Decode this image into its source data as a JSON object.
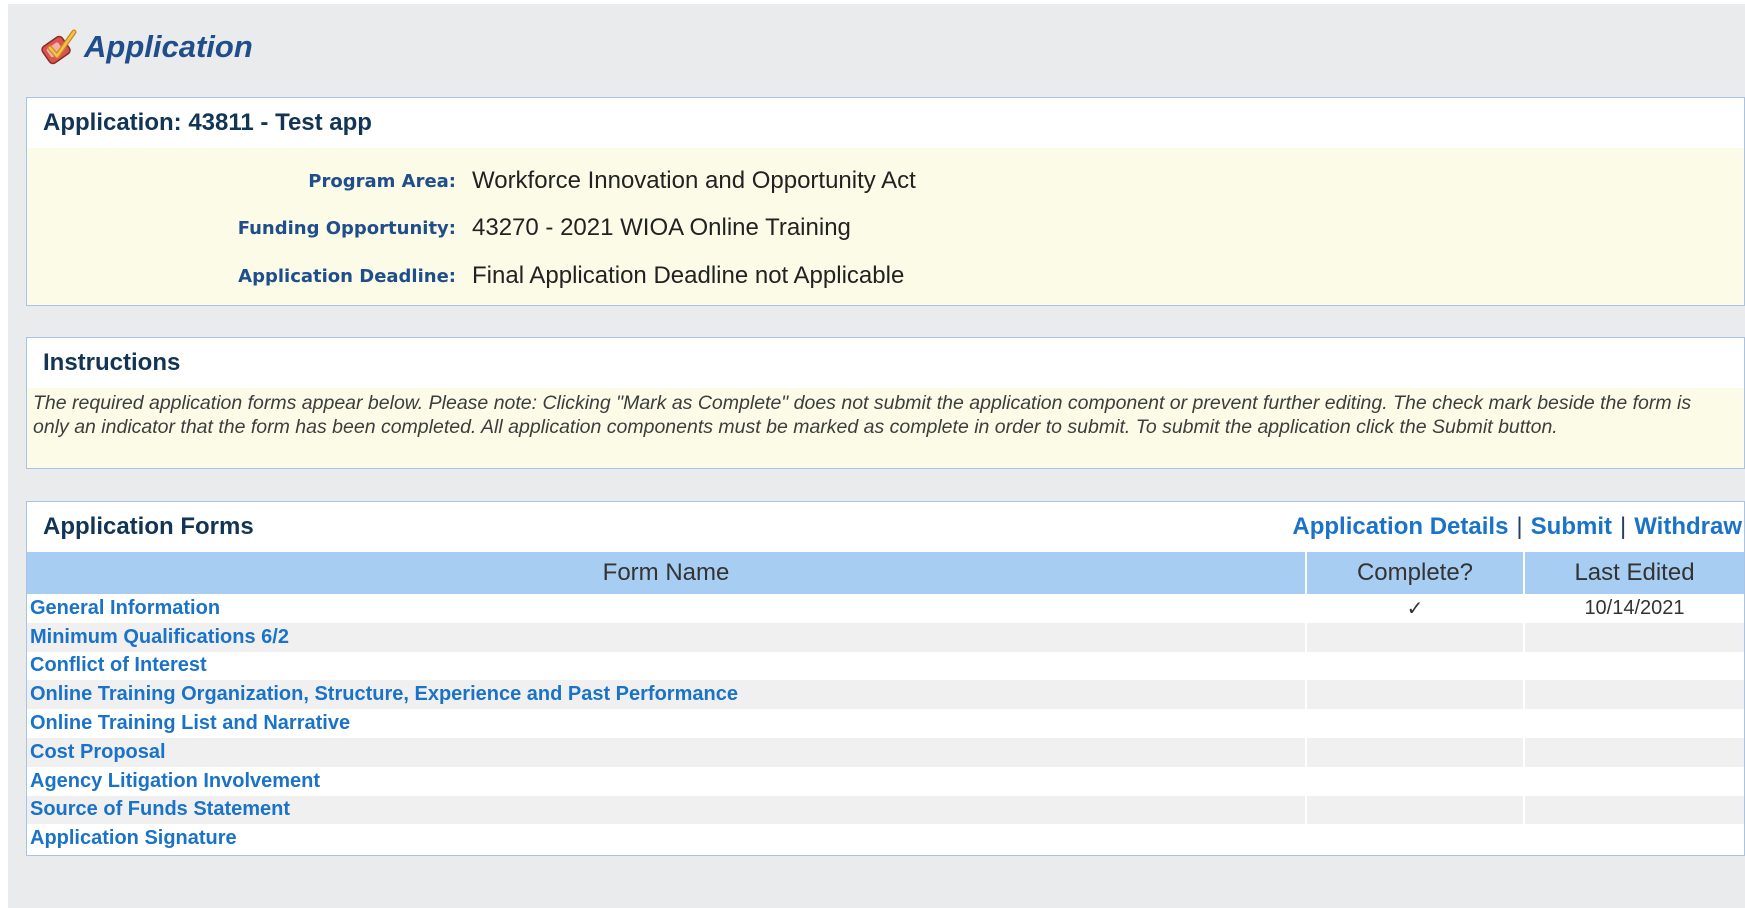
{
  "page": {
    "title": "Application",
    "icon": "checkmark-clipboard-icon"
  },
  "details": {
    "heading": "Application: 43811 - Test app",
    "fields": [
      {
        "label": "Program Area:",
        "value": "Workforce Innovation and Opportunity Act"
      },
      {
        "label": "Funding Opportunity:",
        "value": "43270 - 2021 WIOA Online Training"
      },
      {
        "label": "Application Deadline:",
        "value": "Final Application Deadline not Applicable"
      }
    ]
  },
  "instructions": {
    "heading": "Instructions",
    "text": "The required application forms appear below. Please note: Clicking \"Mark as Complete\" does not submit the application component or prevent further editing. The check mark beside the form is only an indicator that the form has been completed. All application components must be marked as complete in order to submit. To submit the application click the Submit button."
  },
  "forms": {
    "heading": "Application Forms",
    "links": {
      "details": "Application Details",
      "submit": "Submit",
      "withdraw": "Withdraw",
      "separator": "|"
    },
    "columns": [
      "Form Name",
      "Complete?",
      "Last Edited"
    ],
    "rows": [
      {
        "name": "General Information",
        "complete": "✓",
        "last_edited": "10/14/2021"
      },
      {
        "name": "Minimum Qualifications 6/2",
        "complete": "",
        "last_edited": ""
      },
      {
        "name": "Conflict of Interest",
        "complete": "",
        "last_edited": ""
      },
      {
        "name": "Online Training Organization, Structure, Experience and Past Performance",
        "complete": "",
        "last_edited": ""
      },
      {
        "name": "Online Training List and Narrative",
        "complete": "",
        "last_edited": ""
      },
      {
        "name": "Cost Proposal",
        "complete": "",
        "last_edited": ""
      },
      {
        "name": "Agency Litigation Involvement",
        "complete": "",
        "last_edited": ""
      },
      {
        "name": "Source of Funds Statement",
        "complete": "",
        "last_edited": ""
      },
      {
        "name": "Application Signature",
        "complete": "",
        "last_edited": ""
      }
    ]
  },
  "colors": {
    "title": "#1f4e8a",
    "link": "#1a73c8",
    "header_bg": "#a8cdf2",
    "panel_bg": "#fbfbe8"
  }
}
